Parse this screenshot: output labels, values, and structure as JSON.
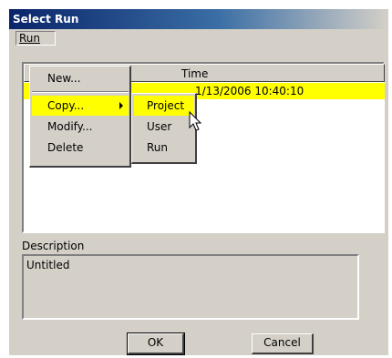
{
  "window": {
    "title": "Select Run"
  },
  "menubar": {
    "run_label": "Run"
  },
  "run_menu": {
    "items": [
      {
        "label": "New..."
      },
      {
        "label": "Copy..."
      },
      {
        "label": "Modify..."
      },
      {
        "label": "Delete"
      }
    ]
  },
  "copy_submenu": {
    "items": [
      {
        "label": "Project"
      },
      {
        "label": "User"
      },
      {
        "label": "Run"
      }
    ]
  },
  "table": {
    "columns": [
      "Time"
    ],
    "rows": [
      {
        "time": "1/13/2006 10:40:10"
      }
    ]
  },
  "description": {
    "label": "Description",
    "value": "Untitled"
  },
  "buttons": {
    "ok": "OK",
    "cancel": "Cancel"
  },
  "colors": {
    "highlight": "#ffff00",
    "titlebar": "#0a246a",
    "face": "#d4d0c8"
  }
}
